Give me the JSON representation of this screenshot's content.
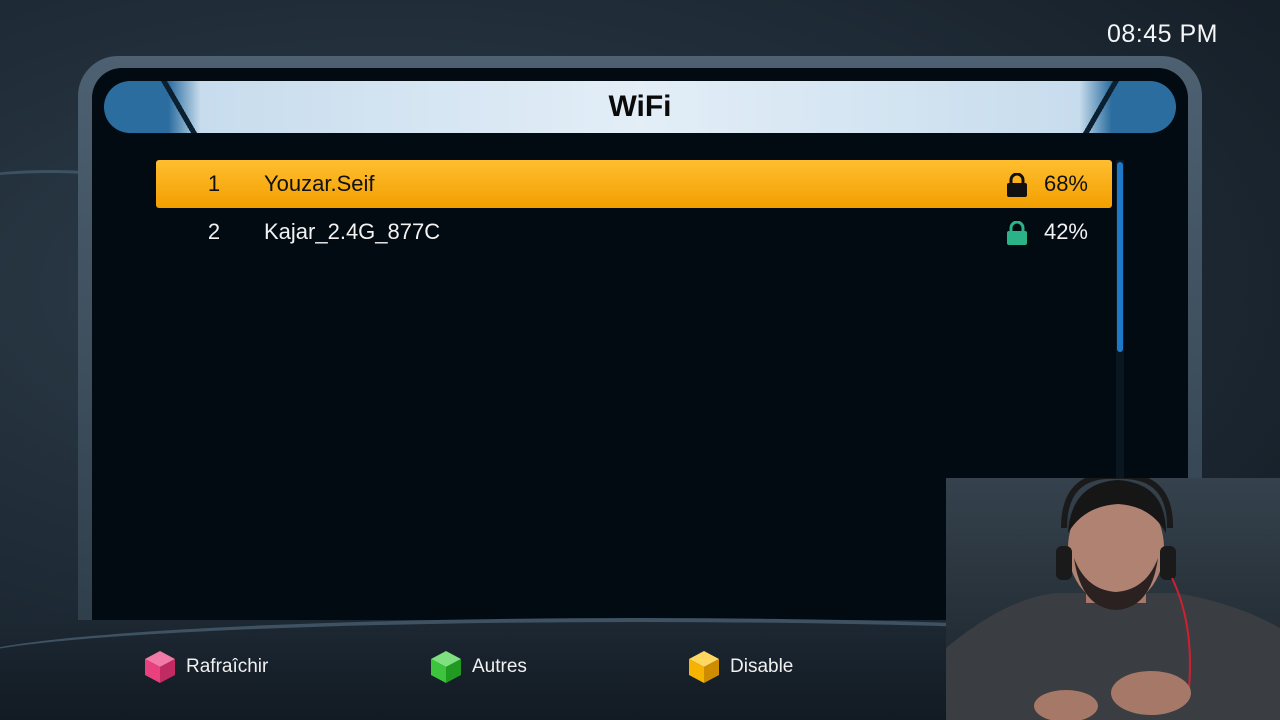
{
  "clock": "08:45 PM",
  "title": "WiFi",
  "networks": [
    {
      "index": "1",
      "ssid": "Youzar.Seif",
      "signal": "68%",
      "locked": true,
      "selected": true
    },
    {
      "index": "2",
      "ssid": "Kajar_2.4G_877C",
      "signal": "42%",
      "locked": true,
      "selected": false
    }
  ],
  "legend": {
    "red": {
      "label": "Rafraîchir",
      "icon": "red-cube-icon",
      "color": "#e8417e"
    },
    "green": {
      "label": "Autres",
      "icon": "green-cube-icon",
      "color": "#3cc43c"
    },
    "yellow": {
      "label": "Disable",
      "icon": "yellow-cube-icon",
      "color": "#f6b400"
    }
  },
  "colors": {
    "selection": "#f7a800",
    "lock_selected": "#111111",
    "lock_normal": "#2bb387",
    "scroll_thumb": "#1e78c8"
  }
}
